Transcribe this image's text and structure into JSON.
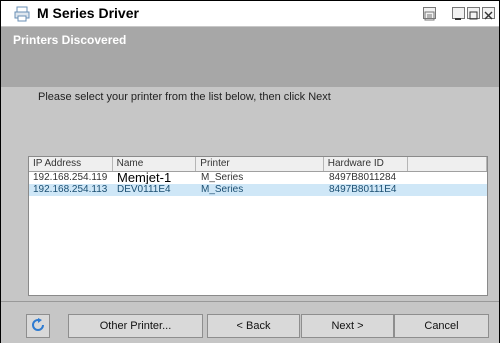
{
  "window": {
    "title": "M Series Driver"
  },
  "header": {
    "title": "Printers Discovered"
  },
  "body": {
    "instruction": "Please select your printer from the list below, then click Next"
  },
  "table": {
    "headers": [
      "IP Address",
      "Name",
      "Printer",
      "Hardware ID",
      ""
    ],
    "rows": [
      {
        "ip": "192.168.254.119",
        "name": "Memjet-1",
        "printer": "M_Series",
        "hwid": "8497B8011284",
        "selected": false
      },
      {
        "ip": "192.168.254.113",
        "name": "DEV0111E4",
        "printer": "M_Series",
        "hwid": "8497B80111E4",
        "selected": true
      }
    ]
  },
  "footer": {
    "other_label": "Other Printer...",
    "back_label": "< Back",
    "next_label": "Next >",
    "cancel_label": "Cancel"
  },
  "icons": {
    "title": "printer-icon",
    "refresh": "refresh-icon"
  },
  "colors": {
    "header_bg": "#a7a7a7",
    "selected_row": "#cfe7f7"
  }
}
